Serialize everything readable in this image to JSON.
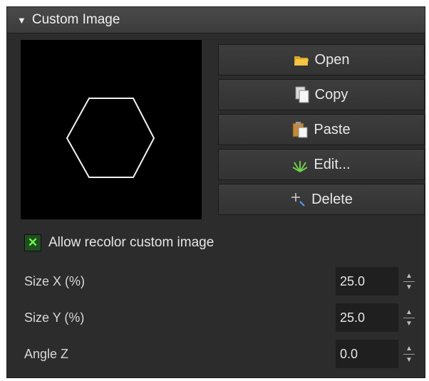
{
  "header": {
    "title": "Custom Image",
    "toggle_icon": "triangle-down-icon"
  },
  "buttons": [
    {
      "label": "Open",
      "icon": "folder-icon"
    },
    {
      "label": "Copy",
      "icon": "copy-icon"
    },
    {
      "label": "Paste",
      "icon": "paste-icon"
    },
    {
      "label": "Edit...",
      "icon": "edit-icon"
    },
    {
      "label": "Delete",
      "icon": "delete-icon"
    }
  ],
  "recolor": {
    "label": "Allow recolor custom image",
    "checked": true
  },
  "properties": [
    {
      "label": "Size X (%)",
      "value": "25.0"
    },
    {
      "label": "Size Y (%)",
      "value": "25.0"
    },
    {
      "label": "Angle Z",
      "value": "0.0"
    }
  ],
  "colors": {
    "panel_bg": "#2c2c2c",
    "preview_bg": "#000000",
    "checkbox_accent": "#6bff4c"
  }
}
